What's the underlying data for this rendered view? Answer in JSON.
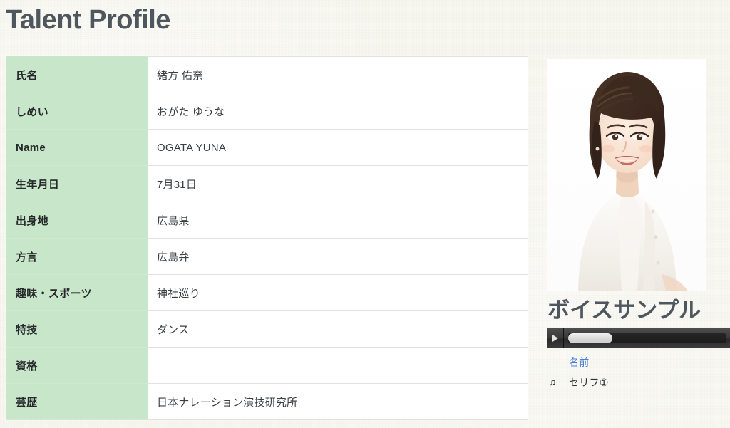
{
  "page": {
    "title": "Talent Profile",
    "background_color": "#f7f6ef",
    "heading_color": "#4f575e"
  },
  "profile": {
    "label_bg_color": "#c8e6c9",
    "rows": [
      {
        "label": "氏名",
        "value": "緒方 佑奈"
      },
      {
        "label": "しめい",
        "value": "おがた ゆうな"
      },
      {
        "label": "Name",
        "value": "OGATA YUNA"
      },
      {
        "label": "生年月日",
        "value": "7月31日"
      },
      {
        "label": "出身地",
        "value": "広島県"
      },
      {
        "label": "方言",
        "value": "広島弁"
      },
      {
        "label": "趣味・スポーツ",
        "value": "神社巡り"
      },
      {
        "label": "特技",
        "value": "ダンス"
      },
      {
        "label": "資格",
        "value": ""
      },
      {
        "label": "芸歴",
        "value": "日本ナレーション演技研究所"
      }
    ]
  },
  "sidebar": {
    "photo": {
      "icon": "talent-portrait-photo",
      "alt": ""
    },
    "voice_sample": {
      "heading": "ボイスサンプル",
      "player": {
        "play_icon": "play-triangle-icon",
        "progress_percent": 28
      },
      "tracks": [
        {
          "icon": "",
          "label": "名前",
          "is_link": true
        },
        {
          "icon": "♫",
          "label": "セリフ①",
          "is_link": false
        }
      ]
    }
  }
}
